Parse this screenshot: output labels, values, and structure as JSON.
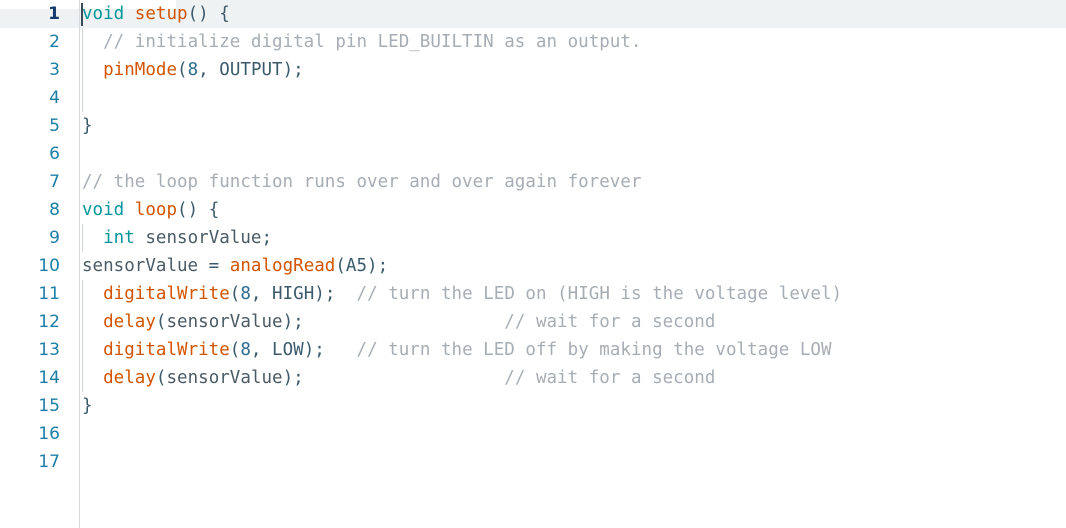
{
  "app": {
    "name": "arduino-code-editor",
    "theme": "light"
  },
  "editor": {
    "total_lines": 17,
    "active_line": 1,
    "cursor": {
      "line": 1,
      "column": 1
    },
    "colors": {
      "background": "#ffffff",
      "current_line_highlight": "#eef2f2",
      "gutter_rule": "#d6dadd",
      "line_number": "#1b7ea6",
      "line_number_active": "#143a6b",
      "keyword": "#00979c",
      "function": "#d35400",
      "constant": "#3b5a6b",
      "number": "#2a6b8f",
      "punctuation": "#3b5a6b",
      "identifier": "#4a5b66",
      "comment": "#a6adb4",
      "indent_guide": "#cdd3d7",
      "caret": "#3b4b57"
    },
    "line_numbers": [
      "1",
      "2",
      "3",
      "4",
      "5",
      "6",
      "7",
      "8",
      "9",
      "10",
      "11",
      "12",
      "13",
      "14",
      "15",
      "16",
      "17"
    ],
    "lines": [
      {
        "n": "1",
        "text": "void setup() {"
      },
      {
        "n": "2",
        "text": "  // initialize digital pin LED_BUILTIN as an output."
      },
      {
        "n": "3",
        "text": "  pinMode(8, OUTPUT);"
      },
      {
        "n": "4",
        "text": ""
      },
      {
        "n": "5",
        "text": "}"
      },
      {
        "n": "6",
        "text": ""
      },
      {
        "n": "7",
        "text": "// the loop function runs over and over again forever"
      },
      {
        "n": "8",
        "text": "void loop() {"
      },
      {
        "n": "9",
        "text": "  int sensorValue;"
      },
      {
        "n": "10",
        "text": "sensorValue = analogRead(A5);"
      },
      {
        "n": "11",
        "text": "  digitalWrite(8, HIGH);  // turn the LED on (HIGH is the voltage level)"
      },
      {
        "n": "12",
        "text": "  delay(sensorValue);                   // wait for a second"
      },
      {
        "n": "13",
        "text": "  digitalWrite(8, LOW);   // turn the LED off by making the voltage LOW"
      },
      {
        "n": "14",
        "text": "  delay(sensorValue);                   // wait for a second"
      },
      {
        "n": "15",
        "text": "}"
      },
      {
        "n": "16",
        "text": ""
      },
      {
        "n": "17",
        "text": ""
      }
    ],
    "tokens": {
      "l1": {
        "kw_void": "void",
        "fn_setup": "setup",
        "parens": "() ",
        "brace_open": "{"
      },
      "l2": {
        "indent": "  ",
        "comment": "// initialize digital pin LED_BUILTIN as an output."
      },
      "l3": {
        "indent": "  ",
        "fn": "pinMode",
        "open": "(",
        "num": "8",
        "comma": ", ",
        "const": "OUTPUT",
        "close": ");"
      },
      "l5": {
        "brace_close": "}"
      },
      "l7": {
        "comment": "// the loop function runs over and over again forever"
      },
      "l8": {
        "kw_void": "void",
        "fn_loop": "loop",
        "parens": "() ",
        "brace_open": "{"
      },
      "l9": {
        "indent": "  ",
        "kw_int": "int",
        "space": " ",
        "ident": "sensorValue",
        "semi": ";"
      },
      "l10": {
        "ident": "sensorValue",
        "eq": " = ",
        "fn": "analogRead",
        "open": "(",
        "const": "A5",
        "close": ");"
      },
      "l11": {
        "indent": "  ",
        "fn": "digitalWrite",
        "open": "(",
        "num": "8",
        "comma": ", ",
        "const": "HIGH",
        "close": ");",
        "gap": "  ",
        "comment": "// turn the LED on (HIGH is the voltage level)"
      },
      "l12": {
        "indent": "  ",
        "fn": "delay",
        "open": "(",
        "ident": "sensorValue",
        "close": ");",
        "gap": "                   ",
        "comment": "// wait for a second"
      },
      "l13": {
        "indent": "  ",
        "fn": "digitalWrite",
        "open": "(",
        "num": "8",
        "comma": ", ",
        "const": "LOW",
        "close": ");",
        "gap": "   ",
        "comment": "// turn the LED off by making the voltage LOW"
      },
      "l14": {
        "indent": "  ",
        "fn": "delay",
        "open": "(",
        "ident": "sensorValue",
        "close": ");",
        "gap": "                   ",
        "comment": "// wait for a second"
      },
      "l15": {
        "brace_close": "}"
      }
    }
  }
}
